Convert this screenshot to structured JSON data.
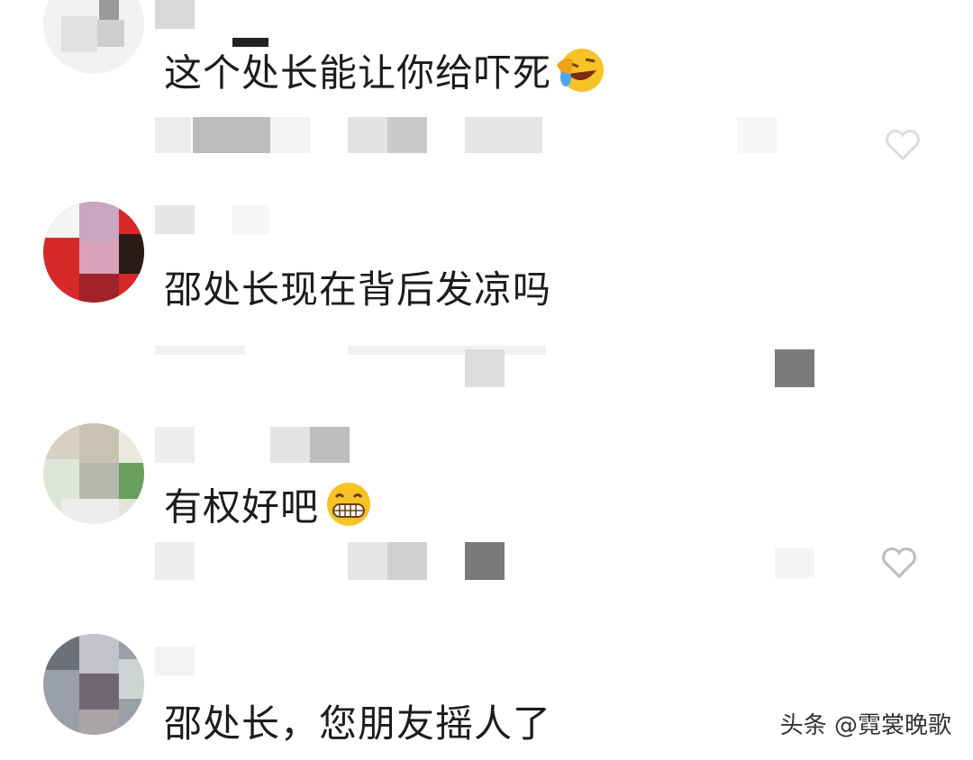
{
  "comments": [
    {
      "text": "这个处长能让你给吓死",
      "emoji": "rofl-emoji"
    },
    {
      "text": "邵处长现在背后发凉吗",
      "emoji": ""
    },
    {
      "text": "有权好吧",
      "emoji": "grin-emoji"
    },
    {
      "text": "邵处长，您朋友摇人了",
      "emoji": ""
    }
  ],
  "watermark": {
    "text": "头条 @霓裳晚歌"
  },
  "colors": {
    "text": "#1c1c1c",
    "blur_light": "#e6e6e6",
    "blur_mid": "#b9b9b9",
    "blur_dark": "#6f6f6f"
  }
}
